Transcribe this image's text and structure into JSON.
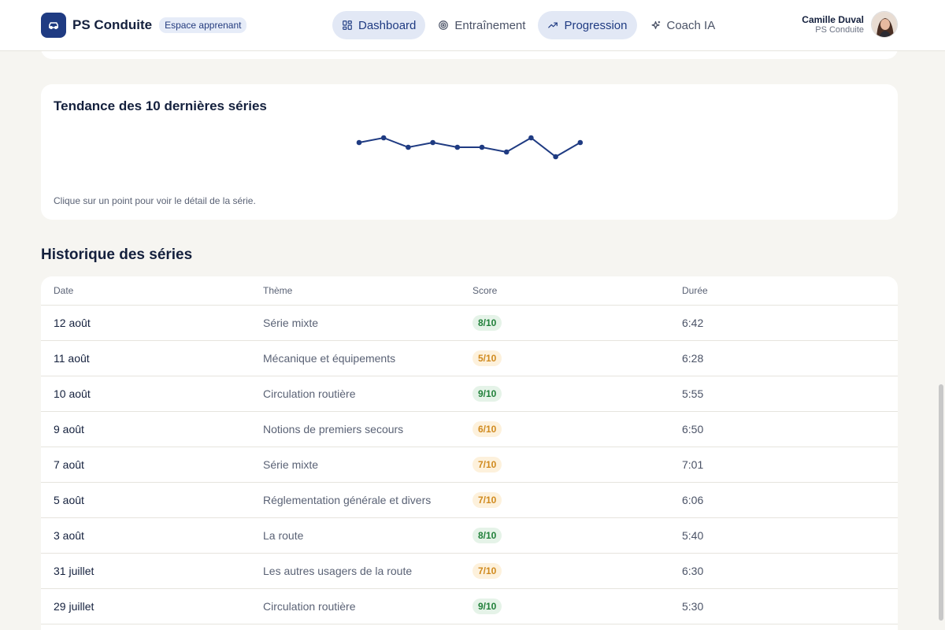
{
  "header": {
    "brand": "PS Conduite",
    "space_badge": "Espace apprenant",
    "nav": [
      {
        "label": "Dashboard",
        "icon": "dashboard-icon",
        "active": true
      },
      {
        "label": "Entraînement",
        "icon": "target-icon",
        "active": false
      },
      {
        "label": "Progression",
        "icon": "trend-icon",
        "active": true
      },
      {
        "label": "Coach IA",
        "icon": "sparkle-icon",
        "active": false
      }
    ],
    "user": {
      "name": "Camille Duval",
      "org": "PS Conduite"
    }
  },
  "trend": {
    "title": "Tendance des 10 dernières séries",
    "hint": "Clique sur un point pour voir le détail de la série."
  },
  "chart_data": {
    "type": "line",
    "title": "Tendance des 10 dernières séries",
    "xlabel": "",
    "ylabel": "",
    "x": [
      1,
      2,
      3,
      4,
      5,
      6,
      7,
      8,
      9,
      10
    ],
    "series": [
      {
        "values": [
          7,
          8,
          6,
          7,
          6,
          6,
          5,
          8,
          4,
          7
        ]
      }
    ],
    "ylim": [
      0,
      10
    ],
    "grid": false,
    "color": "#1f3b82"
  },
  "history": {
    "title": "Historique des séries",
    "columns": [
      "Date",
      "Thème",
      "Score",
      "Durée"
    ],
    "rows": [
      {
        "date": "12 août",
        "theme": "Série mixte",
        "score": "8/10",
        "level": "good",
        "duration": "6:42"
      },
      {
        "date": "11 août",
        "theme": "Mécanique et équipements",
        "score": "5/10",
        "level": "mid",
        "duration": "6:28"
      },
      {
        "date": "10 août",
        "theme": "Circulation routière",
        "score": "9/10",
        "level": "good",
        "duration": "5:55"
      },
      {
        "date": "9 août",
        "theme": "Notions de premiers secours",
        "score": "6/10",
        "level": "mid",
        "duration": "6:50"
      },
      {
        "date": "7 août",
        "theme": "Série mixte",
        "score": "7/10",
        "level": "mid",
        "duration": "7:01"
      },
      {
        "date": "5 août",
        "theme": "Réglementation générale et divers",
        "score": "7/10",
        "level": "mid",
        "duration": "6:06"
      },
      {
        "date": "3 août",
        "theme": "La route",
        "score": "8/10",
        "level": "good",
        "duration": "5:40"
      },
      {
        "date": "31 juillet",
        "theme": "Les autres usagers de la route",
        "score": "7/10",
        "level": "mid",
        "duration": "6:30"
      },
      {
        "date": "29 juillet",
        "theme": "Circulation routière",
        "score": "9/10",
        "level": "good",
        "duration": "5:30"
      }
    ]
  },
  "colors": {
    "accent": "#1f3b82",
    "good": "#21803a",
    "mid": "#d08a1e"
  }
}
